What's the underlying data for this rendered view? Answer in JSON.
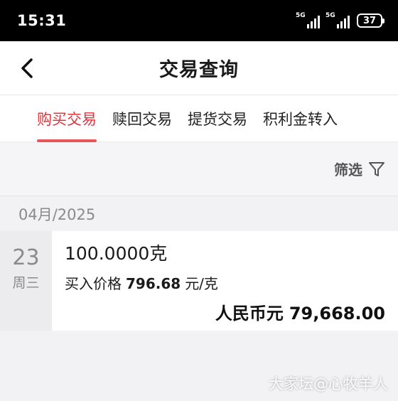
{
  "status_bar": {
    "time": "15:31",
    "network_1": "5G",
    "network_2": "5G",
    "battery": "37"
  },
  "nav": {
    "title": "交易查询",
    "back_icon": "chevron-left-icon"
  },
  "tabs": [
    {
      "label": "购买交易",
      "active": true
    },
    {
      "label": "赎回交易",
      "active": false
    },
    {
      "label": "提货交易",
      "active": false
    },
    {
      "label": "积利金转入",
      "active": false
    }
  ],
  "filter": {
    "label": "筛选",
    "icon": "funnel-icon"
  },
  "month_header": "04月/2025",
  "transaction": {
    "day": "23",
    "weekday": "周三",
    "weight": "100.0000克",
    "price_label": "买入价格",
    "price_value": "796.68",
    "price_unit": "元/克",
    "total_label": "人民币元",
    "total_value": "79,668.00"
  },
  "watermark": "大家坛@心牧羊人",
  "colors": {
    "accent": "#e0343c",
    "status_bar": "#000000"
  }
}
